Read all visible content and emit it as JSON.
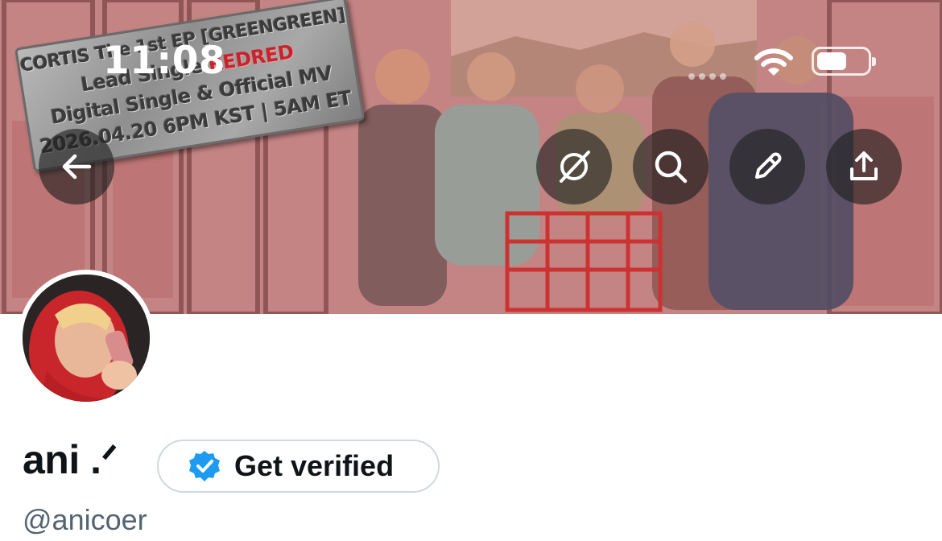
{
  "status_bar": {
    "time": "11:08"
  },
  "banner": {
    "sticker": {
      "line1": "CORTIS The 1st EP [GREENGREEN]",
      "line2_prefix": "Lead Single ",
      "line2_highlight": "REDRED",
      "line3": "Digital Single & Official MV",
      "line4": "2026.04.20 6PM KST | 5AM ET"
    }
  },
  "header_actions": {
    "back": "back-arrow-icon",
    "grok": "grok-icon",
    "search": "search-icon",
    "edit": "pencil-icon",
    "share": "share-icon"
  },
  "profile": {
    "display_name": "ani .ᐟ",
    "verify_button_label": "Get verified",
    "handle": "@anicoer"
  },
  "colors": {
    "verified_badge": "#1d9bf0",
    "handle_text": "#536471",
    "button_border": "#cfd9de"
  }
}
